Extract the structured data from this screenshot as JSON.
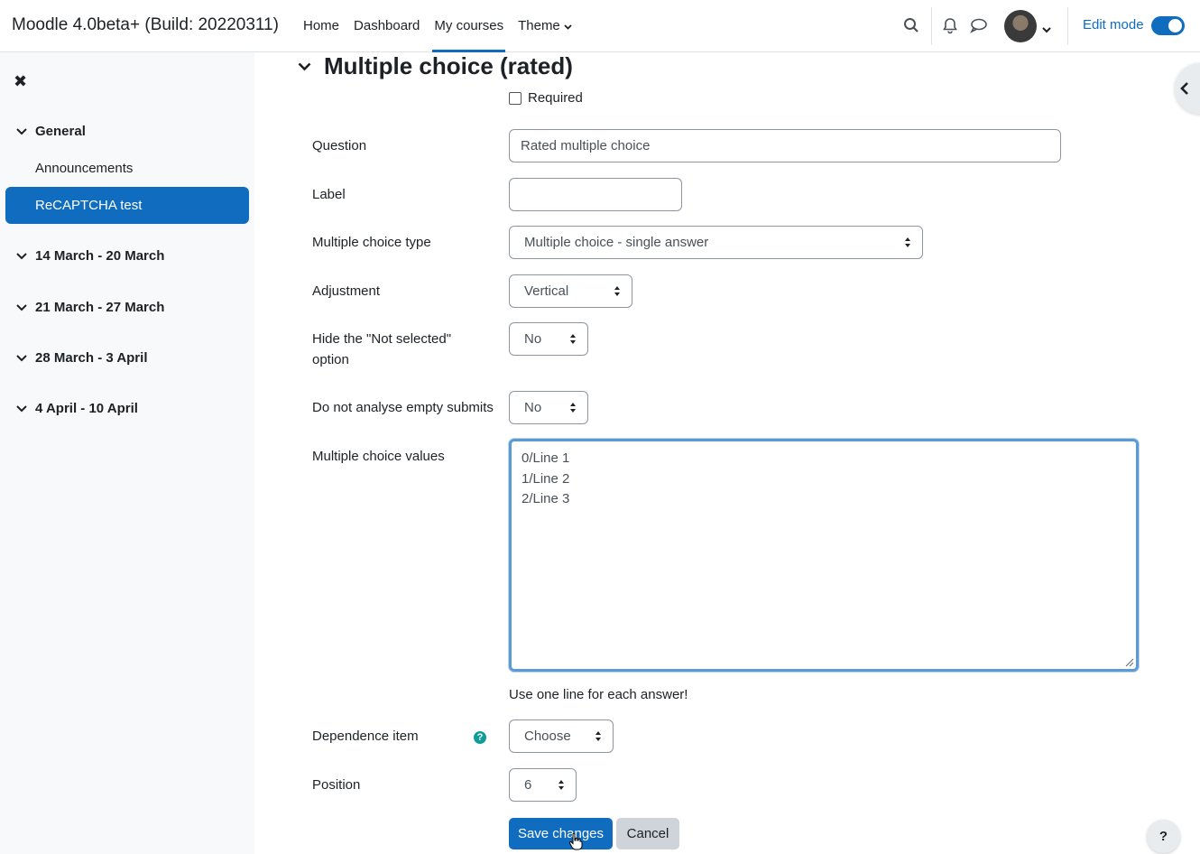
{
  "brand": "Moodle 4.0beta+ (Build: 20220311)",
  "nav": {
    "items": [
      {
        "label": "Home"
      },
      {
        "label": "Dashboard"
      },
      {
        "label": "My courses"
      },
      {
        "label": "Theme"
      }
    ],
    "edit_mode_label": "Edit mode",
    "edit_mode_on": true
  },
  "drawer": {
    "sections": [
      {
        "label": "General",
        "items": [
          "Announcements",
          "ReCAPTCHA test"
        ]
      },
      {
        "label": "14 March - 20 March"
      },
      {
        "label": "21 March - 27 March"
      },
      {
        "label": "28 March - 3 April"
      },
      {
        "label": "4 April - 10 April"
      }
    ]
  },
  "form": {
    "heading": "Multiple choice (rated)",
    "required_label": "Required",
    "question_label": "Question",
    "question_value": "Rated multiple choice",
    "label_label": "Label",
    "label_value": "",
    "type_label": "Multiple choice type",
    "type_value": "Multiple choice - single answer",
    "adjustment_label": "Adjustment",
    "adjustment_value": "Vertical",
    "hide_label": "Hide the \"Not selected\" option",
    "hide_value": "No",
    "noanalyse_label": "Do not analyse empty submits",
    "noanalyse_value": "No",
    "values_label": "Multiple choice values",
    "values_lines": [
      "0/Line 1",
      "1/Line 2",
      "2/Line 3"
    ],
    "values_hint": "Use one line for each answer!",
    "dependence_label": "Dependence item",
    "dependence_value": "Choose",
    "position_label": "Position",
    "position_value": "6",
    "save_label": "Save changes",
    "cancel_label": "Cancel"
  },
  "help_fab": "?",
  "colors": {
    "primary": "#0f6cbf",
    "help": "#0f9d99"
  }
}
